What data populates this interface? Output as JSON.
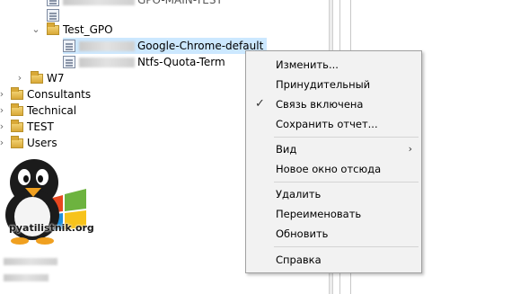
{
  "tree": {
    "top_partial": "GPO-MAIN-TEST",
    "test_gpo": "Test_GPO",
    "link1": "Google-Chrome-default",
    "link2": "Ntfs-Quota-Term",
    "w7": "W7",
    "consultants": "Consultants",
    "technical": "Technical",
    "test": "TEST",
    "users": "Users"
  },
  "logo": {
    "text": "pyatilistnik.org"
  },
  "context_menu": {
    "items": [
      {
        "label": "Изменить..."
      },
      {
        "label": "Принудительный"
      },
      {
        "label": "Связь включена",
        "checked": true
      },
      {
        "label": "Сохранить отчет..."
      },
      {
        "label": "Вид",
        "submenu": true
      },
      {
        "label": "Новое окно отсюда"
      },
      {
        "label": "Удалить"
      },
      {
        "label": "Переименовать"
      },
      {
        "label": "Обновить"
      },
      {
        "label": "Справка"
      }
    ]
  }
}
